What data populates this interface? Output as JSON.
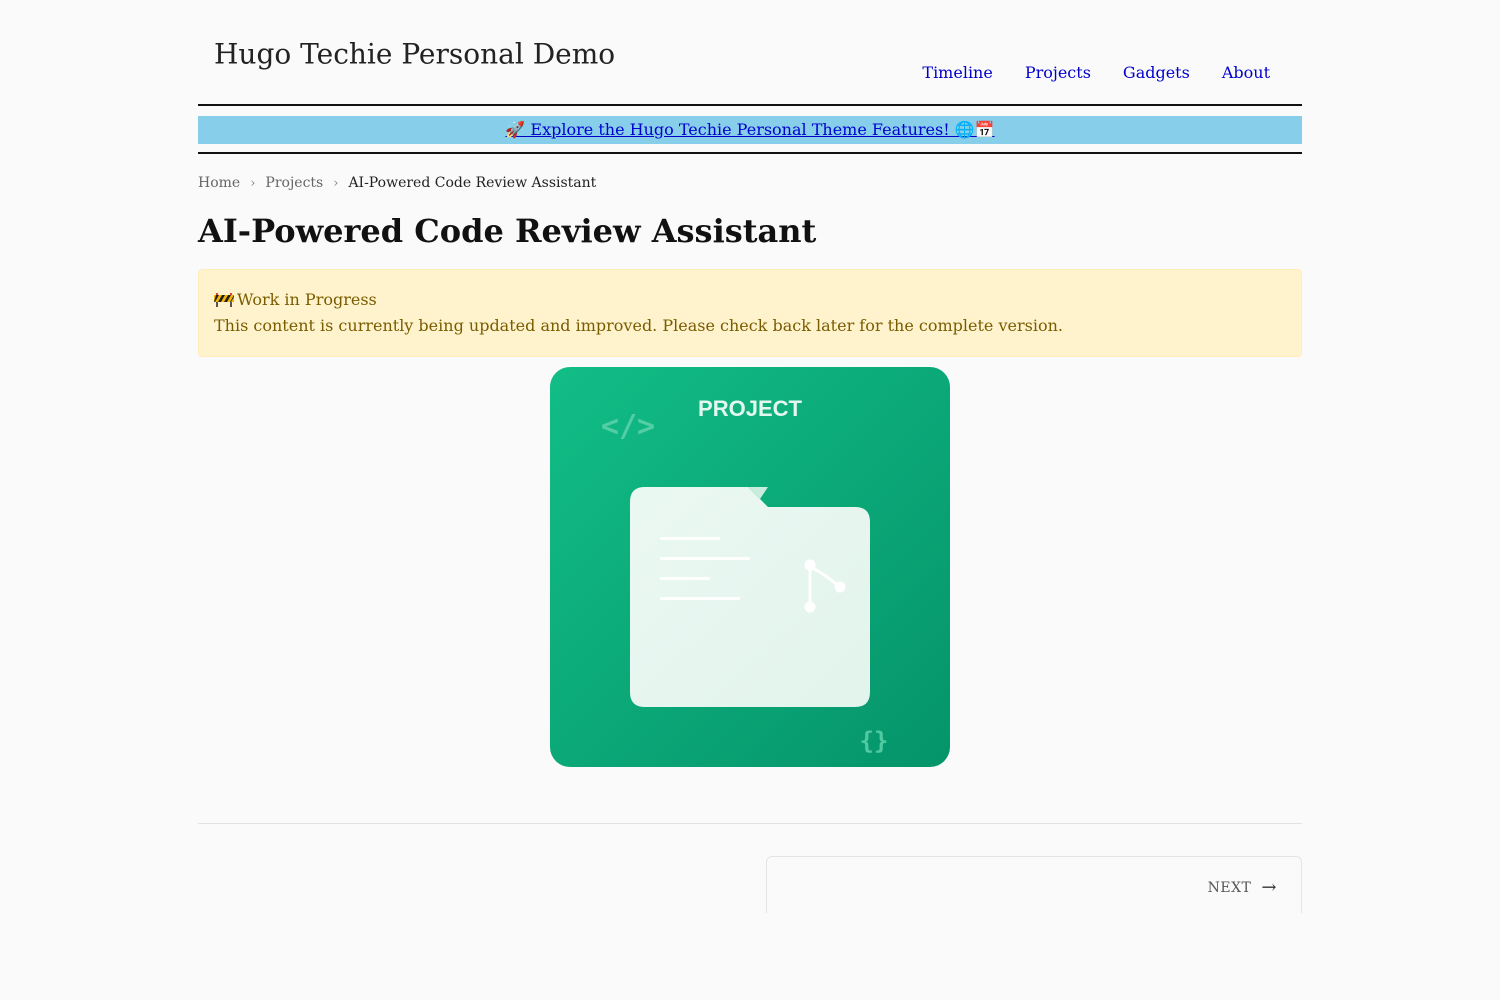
{
  "site": {
    "title": "Hugo Techie Personal Demo"
  },
  "nav": {
    "items": [
      {
        "label": "Timeline"
      },
      {
        "label": "Projects"
      },
      {
        "label": "Gadgets"
      },
      {
        "label": "About"
      }
    ]
  },
  "banner": {
    "text": "🚀 Explore the Hugo Techie Personal Theme Features! 🌐📅",
    "bg_color": "#87ceeb"
  },
  "breadcrumb": {
    "home": "Home",
    "section": "Projects",
    "current": "AI-Powered Code Review Assistant"
  },
  "page": {
    "title": "AI-Powered Code Review Assistant"
  },
  "notice": {
    "icon": "construction-barrier-icon",
    "title": "Work in Progress",
    "body": "This content is currently being updated and improved. Please check back later for the complete version.",
    "bg_color": "#fff3cd",
    "text_color": "#7a5c00"
  },
  "hero": {
    "label": "PROJECT",
    "code_symbol": "</>",
    "brace_symbol": "{}",
    "bg_color": "#10b981"
  },
  "pager": {
    "next_label": "NEXT",
    "next_arrow": "→"
  }
}
